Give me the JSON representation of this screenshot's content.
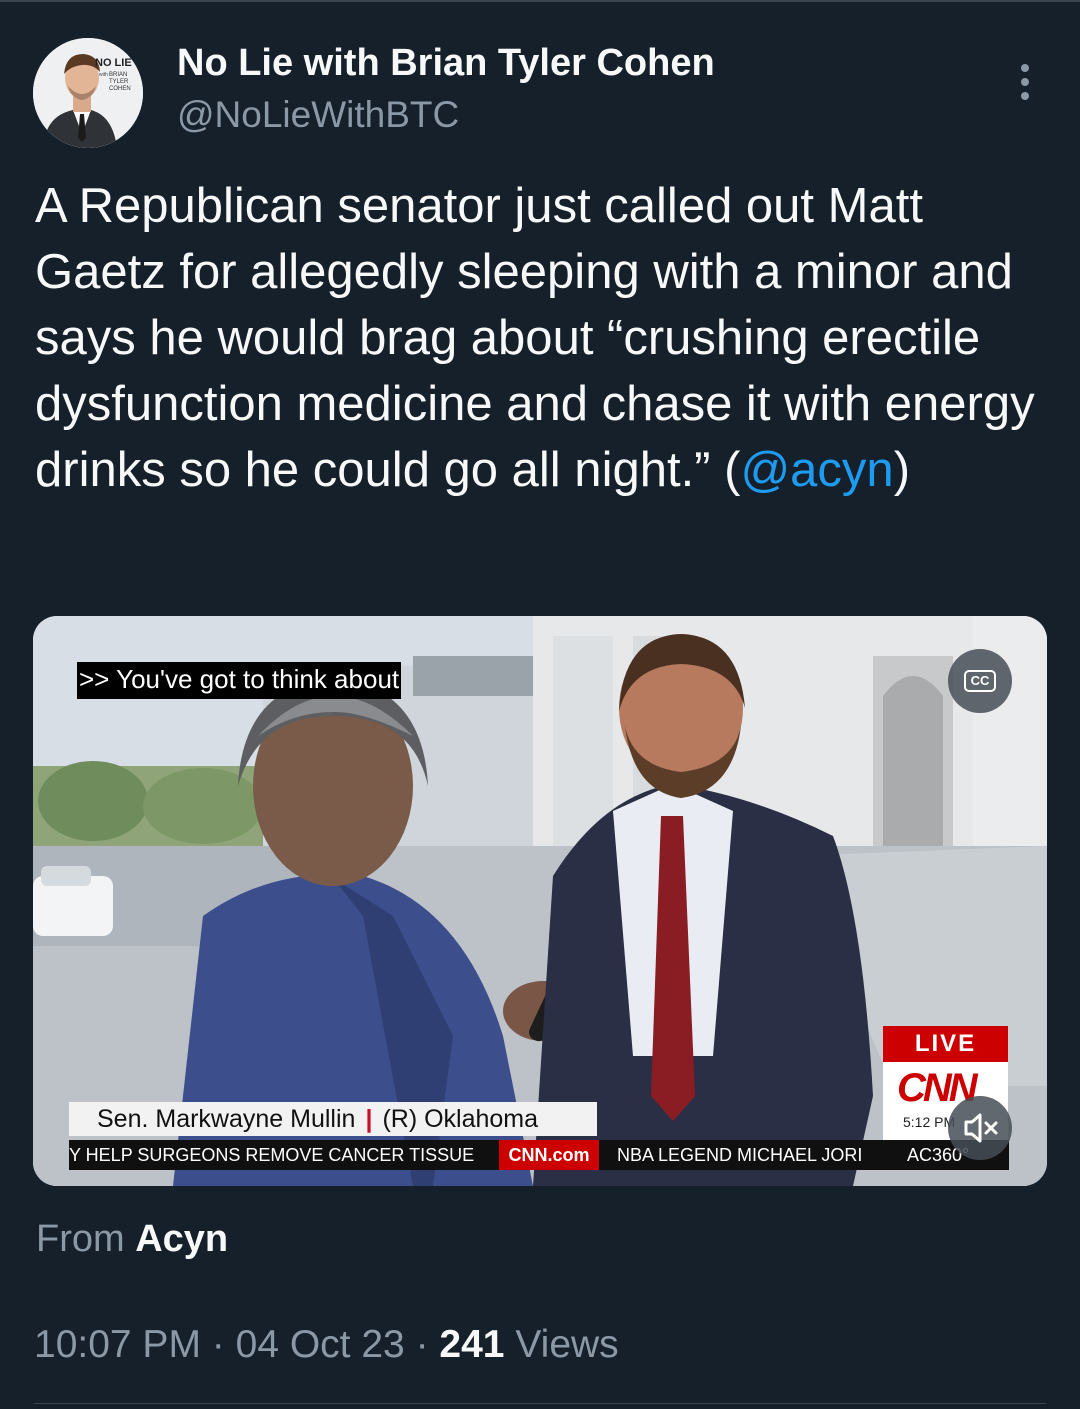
{
  "author": {
    "display_name": "No Lie with Brian Tyler Cohen",
    "handle": "@NoLieWithBTC",
    "avatar_text": [
      "NO LIE",
      "with",
      "BRIAN",
      "TYLER",
      "COHEN"
    ]
  },
  "tweet": {
    "text_before": "A Republican senator just called out Matt Gaetz for allegedly sleeping with a minor and says he would brag about “crushing erectile dysfunction medicine and chase it with energy drinks so he could go all night.” (",
    "mention": "@acyn",
    "text_after": ")"
  },
  "video": {
    "caption": ">> You've got to think about",
    "cc_label": "CC",
    "chyron_name": "Sen. Markwayne Mullin",
    "chyron_party": "(R) Oklahoma",
    "ticker_left": "Y HELP SURGEONS REMOVE CANCER TISSUE",
    "ticker_brand": "CNN.com",
    "ticker_right": "NBA LEGEND MICHAEL JORI",
    "ticker_show": "AC360°",
    "live_label": "LIVE",
    "network": "CNN",
    "time": "5:12 PM"
  },
  "source": {
    "prefix": "From",
    "name": "Acyn"
  },
  "meta": {
    "time": "10:07 PM",
    "dot1": "·",
    "date": "04 Oct 23",
    "dot2": "·",
    "views_count": "241",
    "views_label": "Views"
  },
  "colors": {
    "background": "#15202b",
    "link": "#1d9bf0",
    "secondary_text": "#8b98a5",
    "cnn_red": "#cc0000"
  }
}
